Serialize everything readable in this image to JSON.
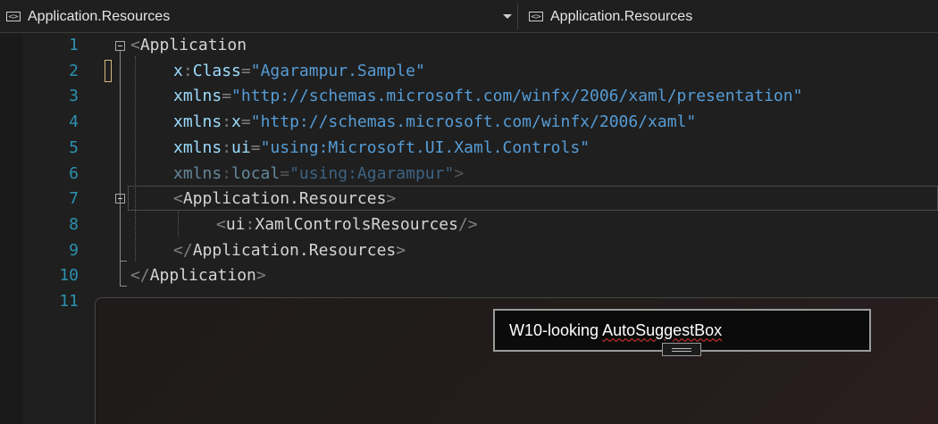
{
  "navbar": {
    "left_dropdown": "Application.Resources",
    "right_dropdown": "Application.Resources"
  },
  "line_numbers": [
    "1",
    "2",
    "3",
    "4",
    "5",
    "6",
    "7",
    "8",
    "9",
    "10",
    "11"
  ],
  "code": {
    "l1": {
      "open": "<",
      "tag": "Application"
    },
    "l2": {
      "attr": "x",
      "colon": ":",
      "attr2": "Class",
      "eq": "=",
      "q1": "\"",
      "val": "Agarampur.Sample",
      "q2": "\""
    },
    "l3": {
      "attr": "xmlns",
      "eq": "=",
      "q1": "\"",
      "val": "http://schemas.microsoft.com/winfx/2006/xaml/presentation",
      "q2": "\""
    },
    "l4": {
      "attr": "xmlns",
      "colon": ":",
      "attr2": "x",
      "eq": "=",
      "q1": "\"",
      "val": "http://schemas.microsoft.com/winfx/2006/xaml",
      "q2": "\""
    },
    "l5": {
      "attr": "xmlns",
      "colon": ":",
      "attr2": "ui",
      "eq": "=",
      "q1": "\"",
      "val": "using:Microsoft.UI.Xaml.Controls",
      "q2": "\""
    },
    "l6": {
      "attr": "xmlns",
      "colon": ":",
      "attr2": "local",
      "eq": "=",
      "q1": "\"",
      "val": "using:Agarampur",
      "q2": "\"",
      "close": ">"
    },
    "l7": {
      "open": "<",
      "tag": "Application.Resources",
      "close": ">"
    },
    "l8": {
      "open": "<",
      "prefix": "ui",
      "colon": ":",
      "tag": "XamlControlsResources",
      "close": "/>"
    },
    "l9": {
      "open": "</",
      "tag": "Application.Resources",
      "close": ">"
    },
    "l10": {
      "open": "</",
      "tag": "Application",
      "close": ">"
    }
  },
  "preview": {
    "suggest_text_plain": "W10-looking ",
    "suggest_text_underlined": "AutoSuggestBox"
  },
  "colors": {
    "line_number": "#2b91af",
    "attribute": "#9cdcfe",
    "string": "#569cd6",
    "punctuation": "#808080",
    "spell_error": "#e53935"
  }
}
